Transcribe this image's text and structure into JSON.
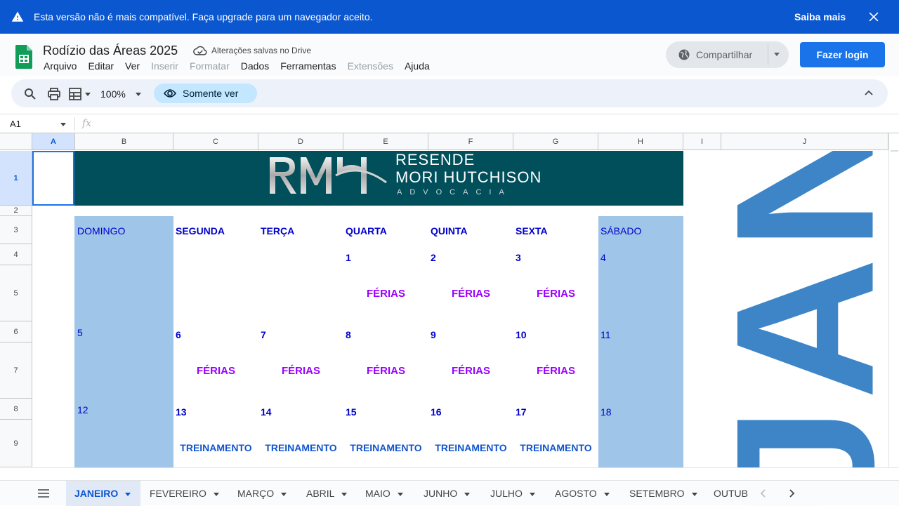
{
  "banner": {
    "message": "Esta versão não é mais compatível. Faça upgrade para um navegador aceito.",
    "learn_more": "Saiba mais",
    "color": "#0b57d0"
  },
  "header": {
    "title": "Rodízio das Áreas 2025",
    "save_status": "Alterações salvas no Drive",
    "menus": [
      "Arquivo",
      "Editar",
      "Ver",
      "Inserir",
      "Formatar",
      "Dados",
      "Ferramentas",
      "Extensões",
      "Ajuda"
    ],
    "disabled_menus": [
      "Inserir",
      "Formatar",
      "Extensões"
    ],
    "share_label": "Compartilhar",
    "login_label": "Fazer login"
  },
  "toolbar": {
    "zoom": "100%",
    "view_only": "Somente ver"
  },
  "formula_bar": {
    "cell_ref": "A1",
    "fx": "fx"
  },
  "columns": [
    "A",
    "B",
    "C",
    "D",
    "E",
    "F",
    "G",
    "H",
    "I",
    "J"
  ],
  "rows": [
    "1",
    "2",
    "3",
    "4",
    "5",
    "6",
    "7",
    "8",
    "9"
  ],
  "logo": {
    "monogram": "RMH",
    "line1": "RESENDE",
    "line2": "MORI HUTCHISON",
    "line3": "ADVOCACIA",
    "bg_color": "#004f5a"
  },
  "calendar": {
    "weekdays": [
      "DOMINGO",
      "SEGUNDA",
      "TERÇA",
      "QUARTA",
      "QUINTA",
      "SEXTA",
      "SÁBADO"
    ],
    "week1": [
      "",
      "",
      "",
      "1",
      "2",
      "3",
      "4"
    ],
    "week1_events": [
      "",
      "",
      "",
      "FÉRIAS",
      "FÉRIAS",
      "FÉRIAS",
      ""
    ],
    "week2": [
      "5",
      "6",
      "7",
      "8",
      "9",
      "10",
      "11"
    ],
    "week2_events": [
      "",
      "FÉRIAS",
      "FÉRIAS",
      "FÉRIAS",
      "FÉRIAS",
      "FÉRIAS",
      ""
    ],
    "week3": [
      "12",
      "13",
      "14",
      "15",
      "16",
      "17",
      "18"
    ],
    "week3_events": [
      "",
      "TREINAMENTO",
      "TREINAMENTO",
      "TREINAMENTO",
      "TREINAMENTO",
      "TREINAMENTO",
      ""
    ],
    "month_label": "JAN",
    "weekend_color": "#9fc5e8",
    "ferias_color": "#9900ff",
    "treinamento_color": "#1155cc"
  },
  "sheet_tabs": [
    "JANEIRO",
    "FEVEREIRO",
    "MARÇO",
    "ABRIL",
    "MAIO",
    "JUNHO",
    "JULHO",
    "AGOSTO",
    "SETEMBRO",
    "OUTUBRO"
  ],
  "active_tab": "JANEIRO"
}
